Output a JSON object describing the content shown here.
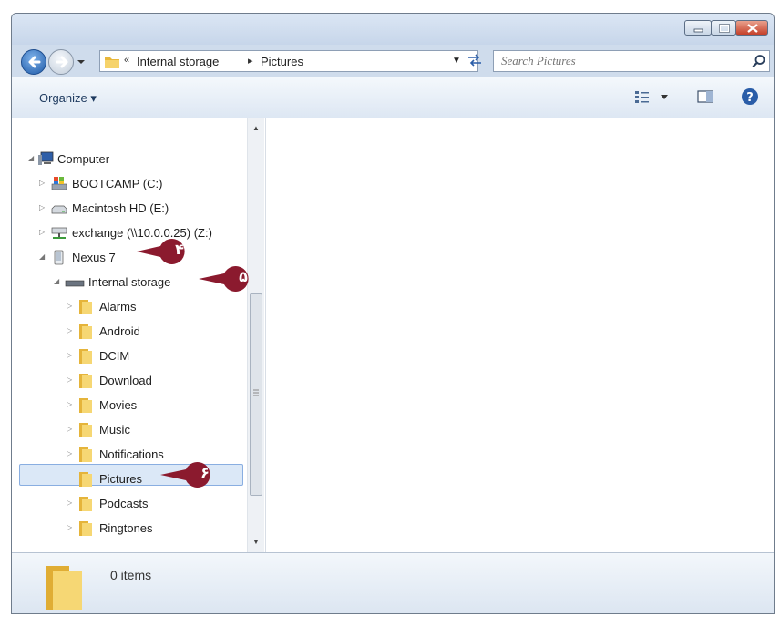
{
  "addressbar": {
    "crumbs": [
      "Internal storage",
      "Pictures"
    ],
    "overflow_marker": "«"
  },
  "search": {
    "placeholder": "Search Pictures"
  },
  "toolbar": {
    "organize_label": "Organize ▾"
  },
  "tree": {
    "computer": "Computer",
    "bootcamp": "BOOTCAMP (C:)",
    "macintosh": "Macintosh HD (E:)",
    "exchange": "exchange (\\\\10.0.0.25) (Z:)",
    "nexus": "Nexus 7",
    "internal_storage": "Internal storage",
    "folders": [
      "Alarms",
      "Android",
      "DCIM",
      "Download",
      "Movies",
      "Music",
      "Notifications",
      "Pictures",
      "Podcasts",
      "Ringtones"
    ]
  },
  "callouts": [
    "۴",
    "۵",
    "۶"
  ],
  "status": {
    "item_count": "0 items"
  },
  "colors": {
    "callout": "#8b1a2e",
    "accent": "#1e5aa8",
    "selection": "#dbe8f7"
  }
}
